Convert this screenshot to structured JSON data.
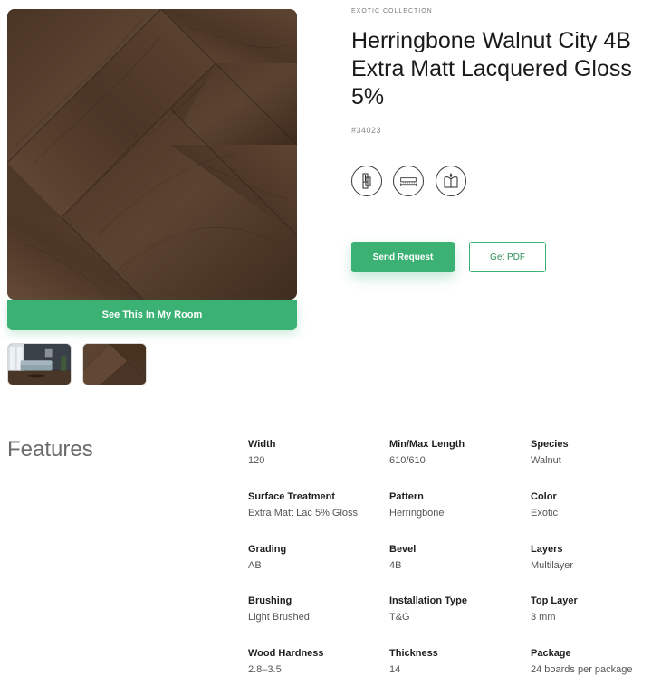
{
  "product": {
    "collection": "EXOTIC COLLECTION",
    "title": "Herringbone Walnut City 4B Extra Matt Lacquered Gloss 5%",
    "sku": "#34023"
  },
  "gallery": {
    "room_button_label": "See This In My Room",
    "thumbnails": [
      "room-scene-thumbnail",
      "walnut-herringbone-thumbnail"
    ]
  },
  "feature_icons": [
    "herringbone-pattern-icon",
    "plank-dimensions-icon",
    "care-book-icon"
  ],
  "actions": {
    "send_request_label": "Send Request",
    "get_pdf_label": "Get PDF"
  },
  "features": {
    "heading": "Features",
    "specs": [
      {
        "label": "Width",
        "value": "120"
      },
      {
        "label": "Min/Max Length",
        "value": "610/610"
      },
      {
        "label": "Species",
        "value": "Walnut"
      },
      {
        "label": "Surface Treatment",
        "value": "Extra Matt Lac 5% Gloss"
      },
      {
        "label": "Pattern",
        "value": "Herringbone"
      },
      {
        "label": "Color",
        "value": "Exotic"
      },
      {
        "label": "Grading",
        "value": "AB"
      },
      {
        "label": "Bevel",
        "value": "4B"
      },
      {
        "label": "Layers",
        "value": "Multilayer"
      },
      {
        "label": "Brushing",
        "value": "Light Brushed"
      },
      {
        "label": "Installation Type",
        "value": "T&G"
      },
      {
        "label": "Top Layer",
        "value": "3 mm"
      },
      {
        "label": "Wood Hardness",
        "value": "2.8–3.5"
      },
      {
        "label": "Thickness",
        "value": "14"
      },
      {
        "label": "Package",
        "value": "24 boards per package"
      }
    ]
  },
  "colors": {
    "accent": "#3bb273",
    "wood_dark": "#3b2a1d",
    "wood_mid": "#5a4230"
  }
}
